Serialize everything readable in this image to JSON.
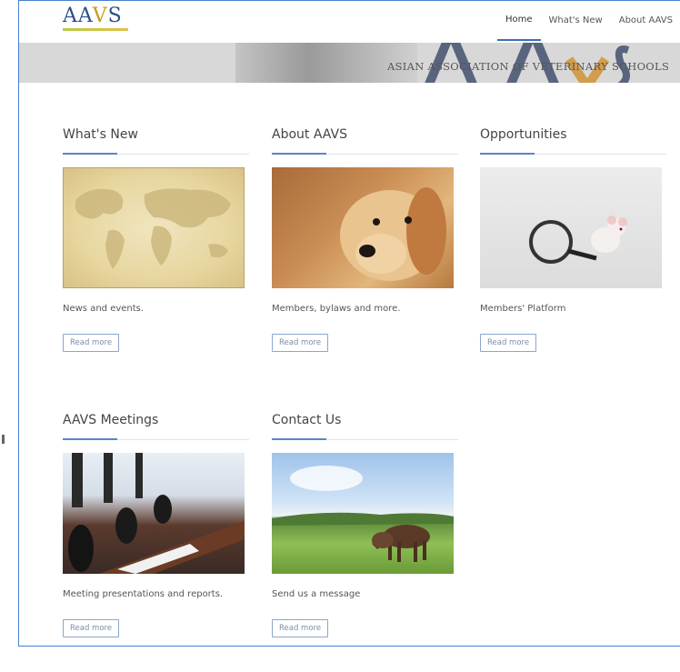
{
  "header": {
    "logo": {
      "text_a": "AA",
      "text_v": "V",
      "text_s": "S"
    },
    "nav": [
      {
        "label": "Home",
        "active": true
      },
      {
        "label": "What's New",
        "active": false
      },
      {
        "label": "About AAVS",
        "active": false
      }
    ]
  },
  "banner": {
    "caption": "ASIAN ASSOCIATION OF VETERINARY SCHOOLS"
  },
  "cards": [
    {
      "title": "What's New",
      "description": "News and events.",
      "button": "Read more",
      "image": "world-map"
    },
    {
      "title": "About AAVS",
      "description": "Members, bylaws and more.",
      "button": "Read more",
      "image": "golden-retriever"
    },
    {
      "title": "Opportunities",
      "description": "Members' Platform",
      "button": "Read more",
      "image": "mouse-with-magnifier"
    },
    {
      "title": "AAVS Meetings",
      "description": "Meeting presentations and reports.",
      "button": "Read more",
      "image": "conference-room"
    },
    {
      "title": "Contact Us",
      "description": "Send us a message",
      "button": "Read more",
      "image": "horse-in-field"
    }
  ],
  "colors": {
    "accent_blue": "#5a86c4",
    "logo_blue": "#2c4f8a",
    "logo_gold": "#c99a1e",
    "frame_border": "#4a7fd0"
  }
}
